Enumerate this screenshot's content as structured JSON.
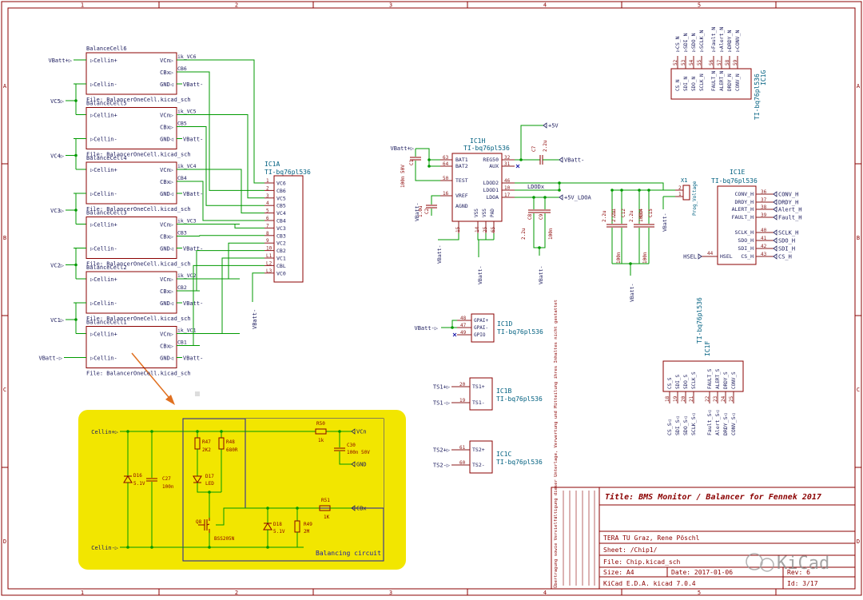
{
  "frame": {
    "cols": [
      "1",
      "2",
      "3",
      "4",
      "5"
    ],
    "rows": [
      "A",
      "B",
      "C",
      "D"
    ]
  },
  "colors": {
    "wire": "#009a00",
    "sym": "#8b0000",
    "text": "#8b0000",
    "label": "#006080",
    "net": "#202060",
    "pin": "#8b1a1a",
    "highlight": "#f2e600",
    "blue": "#1a1aa8",
    "orange": "#e07020"
  },
  "cells": [
    {
      "title": "BalanceCell6",
      "file": "File: BalancerOneCell.kicad_sch",
      "vcn": "ik_VC6",
      "cbx_net": "CB6",
      "in_top": "VBatt+",
      "in_bot": "VC5"
    },
    {
      "title": "BalanceCell5",
      "file": "File: BalancerOneCell.kicad_sch",
      "vcn": "ik_VC5",
      "cbx_net": "CB5",
      "in_top": "VC5",
      "in_bot": "VC4"
    },
    {
      "title": "BalanceCell4",
      "file": "File: BalancerOneCell.kicad_sch",
      "vcn": "ik_VC4",
      "cbx_net": "CB4",
      "in_top": "VC4",
      "in_bot": "VC3"
    },
    {
      "title": "BalanceCell3",
      "file": "File: BalancerOneCell.kicad_sch",
      "vcn": "ik_VC3",
      "cbx_net": "CB3",
      "in_top": "VC3",
      "in_bot": "VC2"
    },
    {
      "title": "BalanceCell2",
      "file": "File: BalancerOneCell.kicad_sch",
      "vcn": "ik_VC2",
      "cbx_net": "CB2",
      "in_top": "VC2",
      "in_bot": "VC1"
    },
    {
      "title": "BalanceCell1",
      "file": "File: BalancerOneCell.kicad_sch",
      "vcn": "ik_VC1",
      "cbx_net": "CB1",
      "in_top": "VC1",
      "in_bot": "VBatt-"
    }
  ],
  "sheet_pins": {
    "top": "Cellin+",
    "bot": "Cellin-",
    "vcn": "VCn",
    "cbx": "CBx",
    "gnd": "GND",
    "vbatt_minus": "VBatt-"
  },
  "ic1a": {
    "ref": "IC1A",
    "part": "TI-bq76pl536",
    "pins": [
      {
        "num": "1",
        "name": "VC6"
      },
      {
        "num": "2",
        "name": "CB6"
      },
      {
        "num": "3",
        "name": "VC5"
      },
      {
        "num": "4",
        "name": "CB5"
      },
      {
        "num": "5",
        "name": "VC4"
      },
      {
        "num": "6",
        "name": "CB4"
      },
      {
        "num": "7",
        "name": "VC3"
      },
      {
        "num": "8",
        "name": "CB3"
      },
      {
        "num": "9",
        "name": "VC2"
      },
      {
        "num": "10",
        "name": "CB2"
      },
      {
        "num": "L1",
        "name": "VC1"
      },
      {
        "num": "L2",
        "name": "CBL"
      },
      {
        "num": "L3",
        "name": "VC0"
      }
    ],
    "vbatt_label": "VBatt-"
  },
  "ic1h": {
    "ref": "IC1H",
    "part": "TI-bq76pl536",
    "left_pins": [
      {
        "num": "63",
        "name": "BAT1"
      },
      {
        "num": "64",
        "name": "BAT2"
      },
      {
        "num": "50",
        "name": "TEST"
      },
      {
        "num": "16",
        "name": "VREF"
      },
      {
        "num": "",
        "name": "AGND"
      }
    ],
    "right_pins": [
      {
        "num": "32",
        "name": "REG50"
      },
      {
        "num": "31",
        "name": "AUX"
      },
      {
        "num": "46",
        "name": "LDOD2"
      },
      {
        "num": "10",
        "name": "LDOD1"
      },
      {
        "num": "17",
        "name": "LDOA"
      }
    ],
    "bottom_pins": [
      "VSS",
      "VSS",
      "PAD"
    ],
    "bottom_nums": [
      "15",
      "14",
      "25",
      "65"
    ],
    "vbatt_plus": "VBatt+",
    "plus5": "+5V",
    "vbatt_minus": "VBatt-",
    "ldodx": "LDODx",
    "plus5_ldoa": "+5V_LDOA",
    "c1": {
      "ref": "C1",
      "val": "100n 50V"
    },
    "c2": {
      "ref": "C2",
      "val": "1.0u"
    },
    "c7": {
      "ref": "C7",
      "val": "2.2u"
    },
    "c8": {
      "ref": "C8",
      "val": "2.2u"
    },
    "c9": {
      "ref": "C9",
      "val": "100n"
    },
    "c11": {
      "ref": "C11",
      "val": "2.2u"
    },
    "c12": {
      "ref": "C12",
      "val": "2.2u"
    },
    "c14": {
      "ref": "C14",
      "val": "2.2u"
    },
    "c15": {
      "ref": "C15",
      "val": "100n"
    },
    "c13": {
      "ref": "C13",
      "val": "100n"
    },
    "c10": {
      "ref": "C10",
      "val": "2.2u"
    }
  },
  "x1": {
    "ref": "X1",
    "val": "Prog_Voltage",
    "pins": [
      "1",
      "2"
    ]
  },
  "ic1e": {
    "ref": "IC1E",
    "part": "TI-bq76pl536",
    "pins": [
      {
        "num": "36",
        "name": "CONV_H",
        "net": "CONV_H"
      },
      {
        "num": "37",
        "name": "DRDY_H",
        "net": "DRDY_H"
      },
      {
        "num": "38",
        "name": "ALERT_H",
        "net": "Alert_H"
      },
      {
        "num": "39",
        "name": "FAULT_H",
        "net": "Fault_H"
      },
      {
        "num": "40",
        "name": "SCLK_H",
        "net": "SCLK_H"
      },
      {
        "num": "41",
        "name": "SDO_H",
        "net": "SDO_H"
      },
      {
        "num": "42",
        "name": "SDI_H",
        "net": "SDI_H"
      },
      {
        "num": "43",
        "name": "CS_H",
        "net": "CS_H"
      }
    ],
    "hsel_pin": {
      "num": "44",
      "name": "HSEL"
    },
    "hsel_net": "HSEL"
  },
  "ic1g": {
    "ref": "IC1G",
    "part": "TI-bq76pl536",
    "pins": [
      {
        "num": "52",
        "name": "CS_N",
        "net": "CS_N"
      },
      {
        "num": "53",
        "name": "SDI_N",
        "net": "SDI_N"
      },
      {
        "num": "54",
        "name": "SDO_N",
        "net": "SDO_N"
      },
      {
        "num": "55",
        "name": "SCLK_N",
        "net": "SCLK_N"
      },
      {
        "num": "56",
        "name": "FAULT_N",
        "net": "Fault_N"
      },
      {
        "num": "57",
        "name": "ALERT_N",
        "net": "Alert_N"
      },
      {
        "num": "58",
        "name": "DRDY_N",
        "net": "DRDY_N"
      },
      {
        "num": "59",
        "name": "CONV_N",
        "net": "CONV_N"
      }
    ]
  },
  "ic1f": {
    "ref": "IC1F",
    "part": "TI-bq76pl536",
    "pins": [
      {
        "num": "18",
        "name": "CS_S",
        "net": "CS_S"
      },
      {
        "num": "19",
        "name": "SDI_S",
        "net": "SDI_S"
      },
      {
        "num": "20",
        "name": "SDO_S",
        "net": "SDO_S"
      },
      {
        "num": "21",
        "name": "SCLK_S",
        "net": "SCLK_S"
      },
      {
        "num": "22",
        "name": "FAULT_S",
        "net": "Fault_S"
      },
      {
        "num": "23",
        "name": "ALERT_S",
        "net": "Alert_S"
      },
      {
        "num": "24",
        "name": "DRDY_S",
        "net": "DRDY_S"
      },
      {
        "num": "25",
        "name": "CONV_S",
        "net": "CONV_S"
      }
    ]
  },
  "ic1d": {
    "ref": "IC1D",
    "part": "TI-bq76pl536",
    "pins": [
      {
        "num": "48",
        "name": "GPAI+"
      },
      {
        "num": "47",
        "name": "GPAI-"
      },
      {
        "num": "49",
        "name": "GPIO"
      }
    ],
    "net": "VBatt-"
  },
  "ic1b": {
    "ref": "IC1B",
    "part": "TI-bq76pl536",
    "pins": [
      {
        "num": "20",
        "name": "TS1+",
        "net": "TS1+"
      },
      {
        "num": "19",
        "name": "TS1-",
        "net": "TS1-"
      }
    ]
  },
  "ic1c": {
    "ref": "IC1C",
    "part": "TI-bq76pl536",
    "pins": [
      {
        "num": "61",
        "name": "TS2+",
        "net": "TS2+"
      },
      {
        "num": "60",
        "name": "TS2-",
        "net": "TS2-"
      }
    ]
  },
  "inset": {
    "cellin_plus": "Cellin+",
    "cellin_minus": "Cellin-",
    "vcn": "VCn",
    "gnd": "GND",
    "cbx": "CBx",
    "r50": {
      "ref": "R50",
      "val": "1k"
    },
    "c30": {
      "ref": "C30",
      "val": "100n 50V"
    },
    "r47": {
      "ref": "R47",
      "val": "2K2"
    },
    "r48": {
      "ref": "R48",
      "val": "680R"
    },
    "d17": {
      "ref": "D17",
      "val": "LED"
    },
    "d16": {
      "ref": "D16",
      "val": "5.1V"
    },
    "c27": {
      "ref": "C27",
      "val": "100n"
    },
    "r51": {
      "ref": "R51",
      "val": "1K"
    },
    "d18": {
      "ref": "D18",
      "val": "5.1V"
    },
    "r49": {
      "ref": "R49",
      "val": "2M"
    },
    "q8": {
      "ref": "Q8",
      "val": "BSS205N"
    },
    "caption": "Balancing circuit"
  },
  "title_block": {
    "title": "Title: BMS Monitor / Balancer for Fennek 2017",
    "company": "TERA TU Graz, Rene Pöschl",
    "sheet": "Sheet: /Chip1/",
    "file": "File: Chip.kicad_sch",
    "size": "Size: A4",
    "date": "Date: 2017-01-06",
    "rev": "Rev: 6",
    "tool": "KiCad E.D.A.  kicad 7.0.4",
    "id": "Id: 3/17",
    "side_note": "Übertragung sowie Vervielfältigung dieser Unterlage, Verwertung und Mitteilung ihres Inhaltes nicht gestattet"
  },
  "watermark": "KiCad"
}
